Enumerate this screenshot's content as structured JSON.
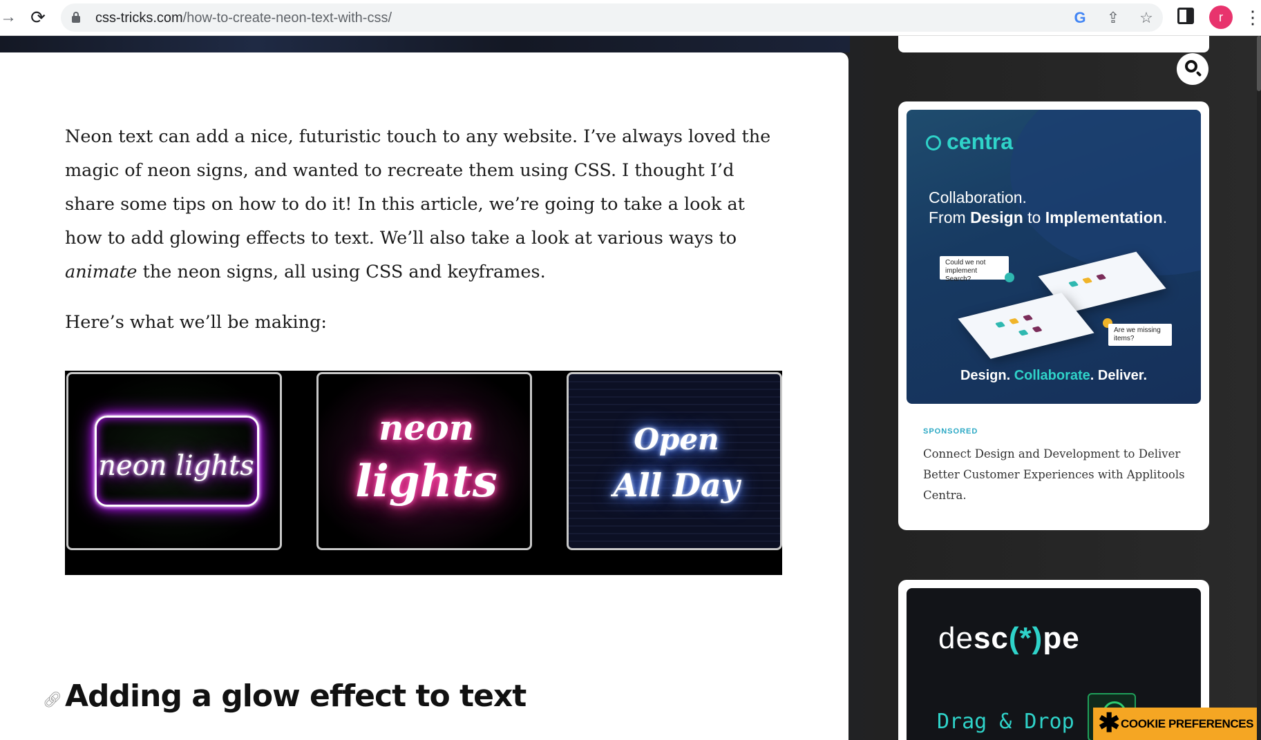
{
  "browser": {
    "url_host": "css-tricks.com",
    "url_path": "/how-to-create-neon-text-with-css/",
    "avatar_letter": "r"
  },
  "article": {
    "intro_part1": "Neon text can add a nice, futuristic touch to any website. I’ve always loved the magic of neon signs, and wanted to recreate them using CSS. I thought I’d share some tips on how to do it! In this article, we’re going to take a look at how to add glowing effects to text. We’ll also take a look at various ways to ",
    "intro_em": "animate",
    "intro_part2": " the neon signs, all using CSS and keyframes.",
    "making": "Here’s what we’ll be making:",
    "demo_tiles": {
      "tile1": "neon lights",
      "tile2_line1": "neon",
      "tile2_line2": "lights",
      "tile3_line1": "Open",
      "tile3_line2": "All Day"
    },
    "heading": "Adding a glow effect to text"
  },
  "sidebar": {
    "ad1": {
      "brand": "centra",
      "tagline_line1": "Collaboration.",
      "tagline_from": "From ",
      "tagline_design": "Design",
      "tagline_to": " to ",
      "tagline_impl": "Implementation",
      "tagline_end": ".",
      "bubble1": "Could we not implement Search?",
      "bubble2": "Are we missing items?",
      "footer_design": "Design. ",
      "footer_collab": "Collaborate",
      "footer_deliver": ". Deliver.",
      "sponsored_label": "SPONSORED",
      "copy": "Connect Design and Development to Deliver Better Customer Experiences with Applitools Centra."
    },
    "ad2": {
      "logo_de": "de",
      "logo_sc": "sc",
      "logo_mark": "(*)",
      "logo_pe": "pe",
      "tagline": "Drag & Drop"
    }
  },
  "cookie": {
    "label": "COOKIE PREFERENCES"
  },
  "colors": {
    "neon_purple": "#bc13fe",
    "neon_pink": "#ff2d95",
    "neon_blue": "#4d7cff",
    "centra_teal": "#2fd3c9",
    "cookie_orange": "#f5a623"
  }
}
